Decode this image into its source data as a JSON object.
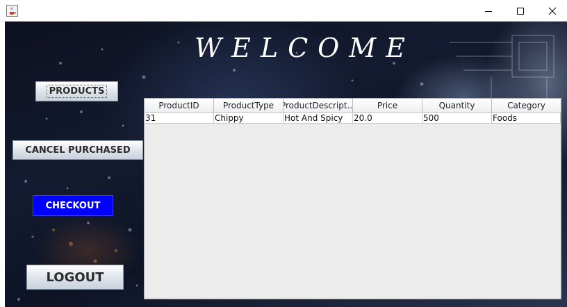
{
  "window": {
    "icon": "java-coffee-icon",
    "controls": [
      "minimize-icon",
      "maximize-icon",
      "close-icon"
    ]
  },
  "header": {
    "title": "WELCOME"
  },
  "sidebar": {
    "products_label": "PRODUCTS",
    "cancel_label": "CANCEL PURCHASED",
    "checkout_label": "CHECKOUT",
    "logout_label": "LOGOUT"
  },
  "table": {
    "columns": [
      "ProductID",
      "ProductType",
      "ProductDescript...",
      "Price",
      "Quantity",
      "Category"
    ],
    "rows": [
      [
        "31",
        "Chippy",
        "Hot And Spicy",
        "20.0",
        "500",
        "Foods"
      ]
    ]
  },
  "colors": {
    "checkout_bg": "#0000ff",
    "title_text": "#ffffff"
  }
}
